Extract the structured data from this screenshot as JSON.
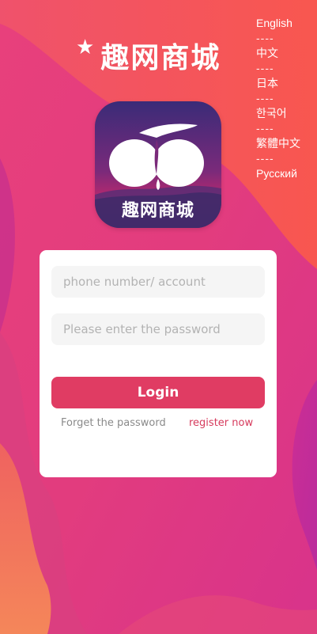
{
  "brand": {
    "title": "趣网商城",
    "star_glyph": "★"
  },
  "languages": {
    "items": [
      "English",
      "中文",
      "日本",
      "한국어",
      "繁體中文",
      "Русский"
    ],
    "separator": "----"
  },
  "logo": {
    "text": "趣网商城"
  },
  "login_form": {
    "account_placeholder": "phone number/ account",
    "password_placeholder": "Please enter the password",
    "login_label": "Login",
    "forget_label": "Forget the password",
    "register_label": "register now"
  },
  "colors": {
    "bg_top_right": "#fb5a4a",
    "bg_left": "#d93187",
    "bg_bottom_left": "#f47a55",
    "login_button": "#e03c63",
    "register_link": "#d63a5c",
    "logo_purple": "#3d2d7a",
    "logo_pink": "#c2286c"
  }
}
